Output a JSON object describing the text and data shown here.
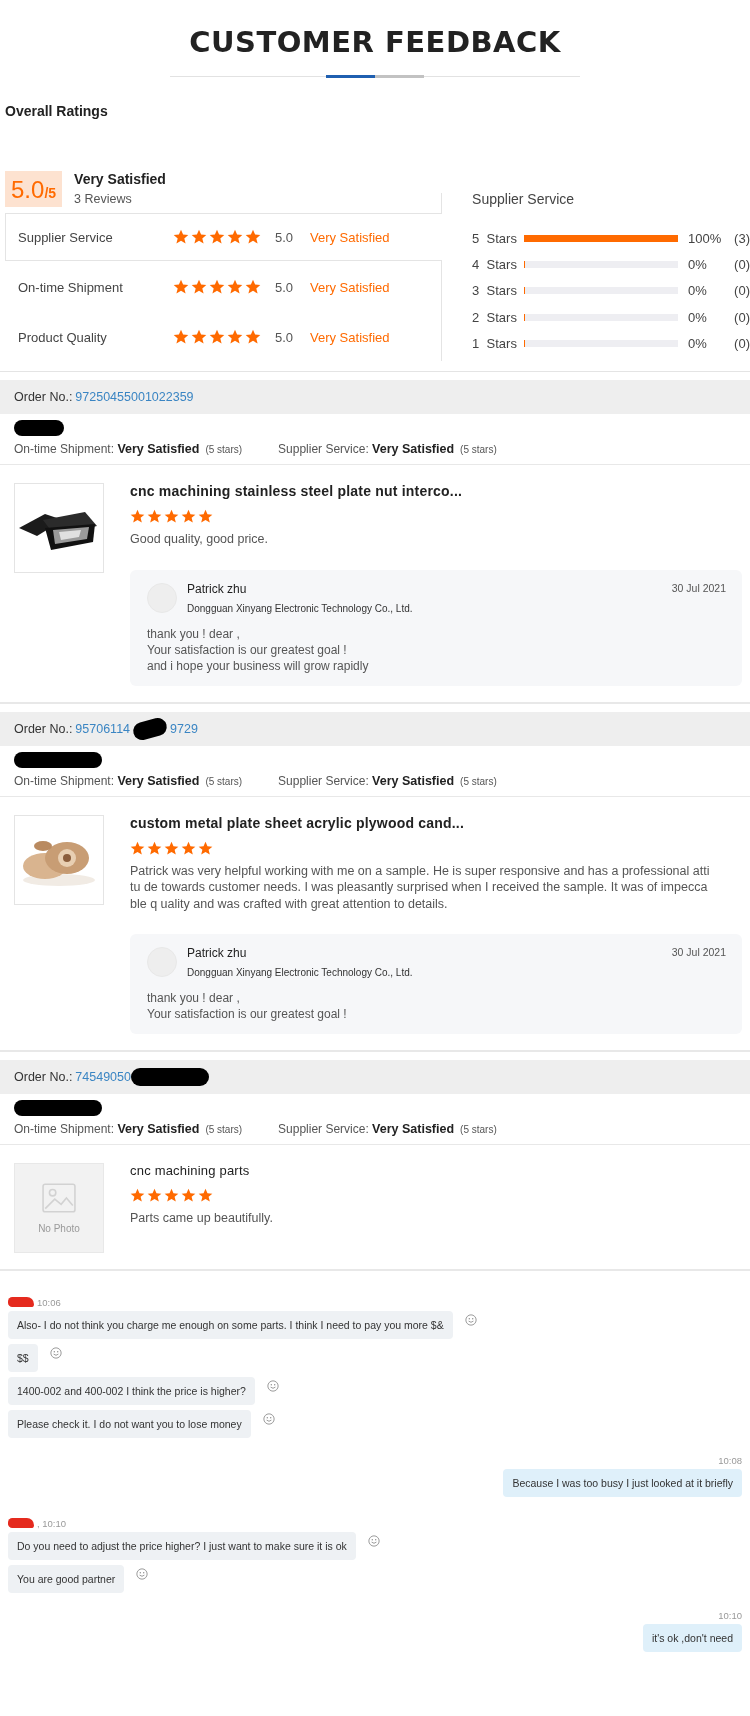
{
  "title": "CUSTOMER FEEDBACK",
  "overall": {
    "heading": "Overall Ratings",
    "score": "5.0",
    "out_of": "/5",
    "verdict": "Very Satisfied",
    "reviews": "3 Reviews",
    "criteria": [
      {
        "name": "Supplier Service",
        "stars": 5,
        "score": "5.0",
        "verdict": "Very Satisfied",
        "selected": true
      },
      {
        "name": "On-time Shipment",
        "stars": 5,
        "score": "5.0",
        "verdict": "Very Satisfied",
        "selected": false
      },
      {
        "name": "Product Quality",
        "stars": 5,
        "score": "5.0",
        "verdict": "Very Satisfied",
        "selected": false
      }
    ]
  },
  "breakdown": {
    "title": "Supplier Service",
    "rows": [
      {
        "num": "5",
        "label": "Stars",
        "level": 1,
        "percent": "100%",
        "count": "(3)"
      },
      {
        "num": "4",
        "label": "Stars",
        "level": 0,
        "percent": "0%",
        "count": "(0)"
      },
      {
        "num": "3",
        "label": "Stars",
        "level": 0,
        "percent": "0%",
        "count": "(0)"
      },
      {
        "num": "2",
        "label": "Stars",
        "level": 0,
        "percent": "0%",
        "count": "(0)"
      },
      {
        "num": "1",
        "label": "Stars",
        "level": 0,
        "percent": "0%",
        "count": "(0)"
      }
    ]
  },
  "reviews": [
    {
      "order_label": "Order No.:",
      "order_parts": [
        "97250455001022359"
      ],
      "redacted_tail": false,
      "reviewer_redacted": true,
      "ratings": [
        {
          "name": "On-time Shipment:",
          "verdict": "Very Satisfied",
          "stars": "(5 stars)"
        },
        {
          "name": "Supplier Service:",
          "verdict": "Very Satisfied",
          "stars": "(5 stars)"
        }
      ],
      "product": {
        "kind": "picture",
        "title": "cnc machining stainless steel plate nut interco...",
        "stars": 5,
        "comment": "Good quality, good price."
      },
      "reply": {
        "author": "Patrick zhu",
        "company": "Dongguan Xinyang Electronic Technology Co., Ltd.",
        "date": "30 Jul 2021",
        "lines": [
          "thank you ! dear ,",
          "Your satisfaction is our greatest goal !",
          "and  i hope your business will grow rapidly"
        ]
      }
    },
    {
      "order_label": "Order No.:",
      "order_parts": [
        "95706114",
        "9729"
      ],
      "redacted_tail": false,
      "reviewer_redacted": true,
      "ratings": [
        {
          "name": "On-time Shipment:",
          "verdict": "Very Satisfied",
          "stars": "(5 stars)"
        },
        {
          "name": "Supplier Service:",
          "verdict": "Very Satisfied",
          "stars": "(5 stars)"
        }
      ],
      "product": {
        "kind": "picture",
        "title": "custom metal plate sheet acrylic plywood cand...",
        "stars": 5,
        "comment": "Patrick was very helpful working with me on a sample. He is super responsive and has a professional attitu de towards customer needs. I was pleasantly surprised when I received the sample. It was of impeccable q uality and was crafted with great attention to details."
      },
      "reply": {
        "author": "Patrick zhu",
        "company": "Dongguan Xinyang Electronic Technology Co., Ltd.",
        "date": "30 Jul 2021",
        "lines": [
          "thank you ! dear ,",
          "Your satisfaction is our greatest goal !"
        ]
      }
    },
    {
      "order_label": "Order No.:",
      "order_parts": [
        "74549050"
      ],
      "redacted_tail": true,
      "reviewer_redacted": true,
      "ratings": [
        {
          "name": "On-time Shipment:",
          "verdict": "Very Satisfied",
          "stars": "(5 stars)"
        },
        {
          "name": "Supplier Service:",
          "verdict": "Very Satisfied",
          "stars": "(5 stars)"
        }
      ],
      "product": {
        "kind": "placeholder",
        "placeholder": "No Photo",
        "title": "cnc machining parts",
        "stars": 5,
        "comment": "Parts came up beautifully."
      }
    }
  ],
  "chat": [
    {
      "kind": "incoming",
      "sender_redacted": true,
      "time": "10:06",
      "bubbles": [
        "Also- I do not think you charge me enough on some parts. I think I need to pay you more $&",
        "$$",
        "1400-002 and 400-002 I think the price is higher?",
        "Please check it. I do not want you to lose money"
      ]
    },
    {
      "kind": "outgoing",
      "sender_redacted": false,
      "time": "10:08",
      "bubbles": [
        "Because I was too busy I just looked at it briefly"
      ]
    },
    {
      "kind": "incoming",
      "sender_redacted": true,
      "time": ", 10:10",
      "bubbles": [
        "Do you need to adjust the price higher? I just want to make sure it is ok",
        "You are good partner"
      ]
    },
    {
      "kind": "outgoing",
      "sender_redacted": false,
      "time": "10:10",
      "bubbles": [
        "it's ok ,don't need"
      ]
    }
  ]
}
